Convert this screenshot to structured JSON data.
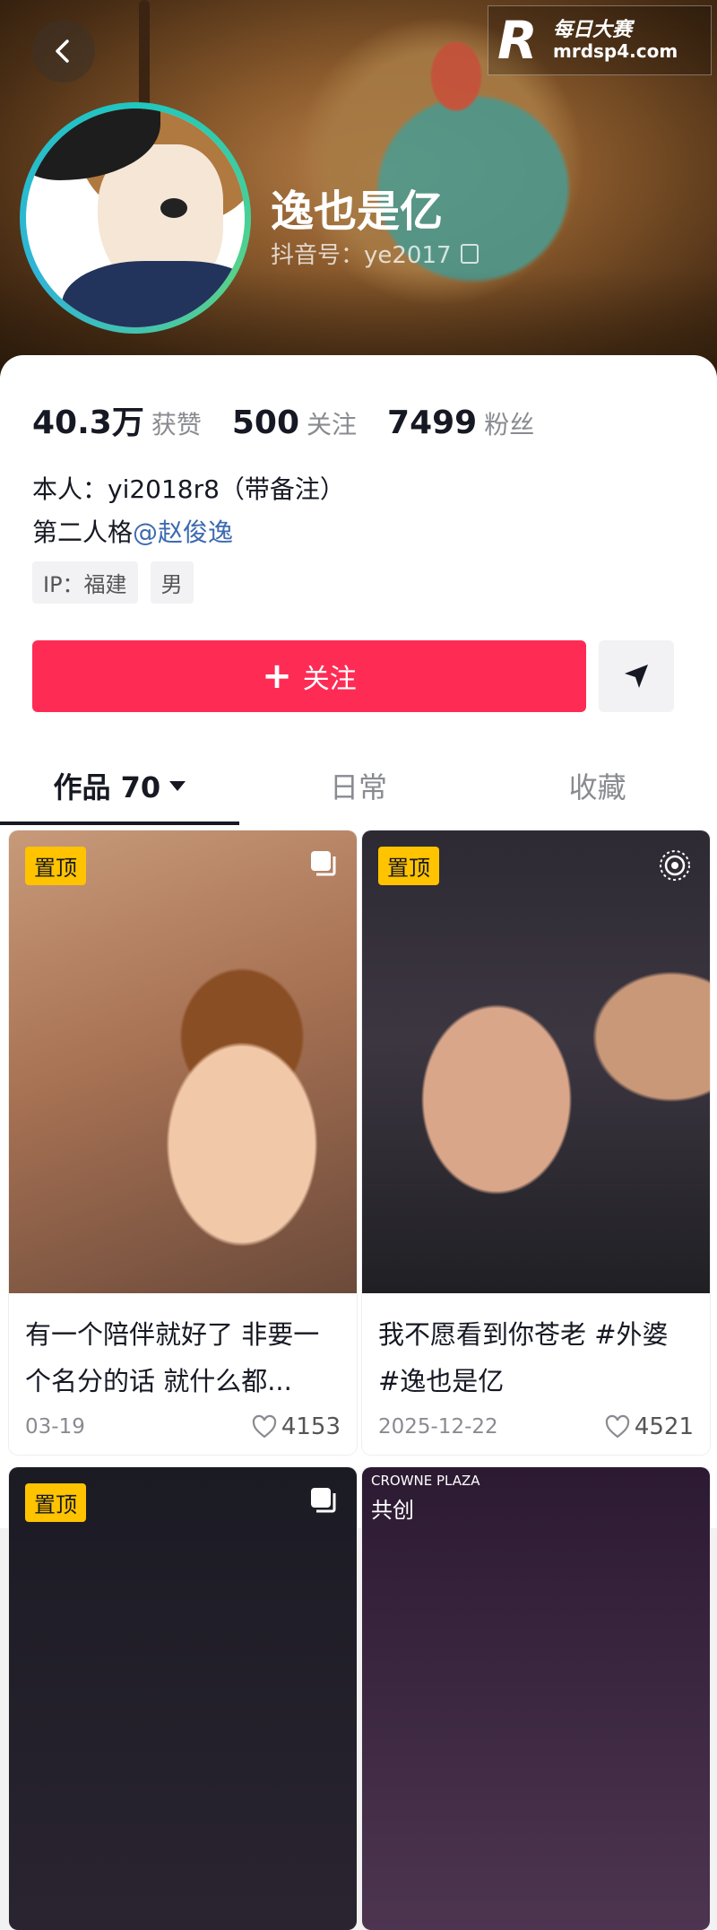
{
  "watermark": {
    "cn": "每日大赛",
    "url": "mrdsp4.com"
  },
  "profile": {
    "nickname": "逸也是亿",
    "douyin_id": "抖音号：ye2017"
  },
  "stats": [
    {
      "value": "40.3万",
      "label": "获赞"
    },
    {
      "value": "500",
      "label": "关注"
    },
    {
      "value": "7499",
      "label": "粉丝"
    }
  ],
  "bio": {
    "line1": "本人：yi2018r8（带备注）",
    "line2_prefix": "第二人格",
    "line2_mention": "@赵俊逸"
  },
  "tags": [
    "IP：福建",
    "男"
  ],
  "actions": {
    "follow_label": "关注"
  },
  "tabs": [
    {
      "label": "作品 70",
      "active": true
    },
    {
      "label": "日常",
      "active": false
    },
    {
      "label": "收藏",
      "active": false
    }
  ],
  "posts": [
    {
      "pinned": "置顶",
      "title": "有一个陪伴就好了 非要一个名分的话 就什么都...",
      "date": "03-19",
      "likes": "4153"
    },
    {
      "pinned": "置顶",
      "title": "我不愿看到你苍老 #外婆 #逸也是亿",
      "date": "2025-12-22",
      "likes": "4521"
    },
    {
      "pinned": "置顶"
    },
    {
      "badge": "共创",
      "sign": "CROWNE PLAZA"
    }
  ],
  "colors": {
    "accent": "#fe2c55",
    "pin": "#ffc300",
    "mention": "#3d6ab0"
  }
}
